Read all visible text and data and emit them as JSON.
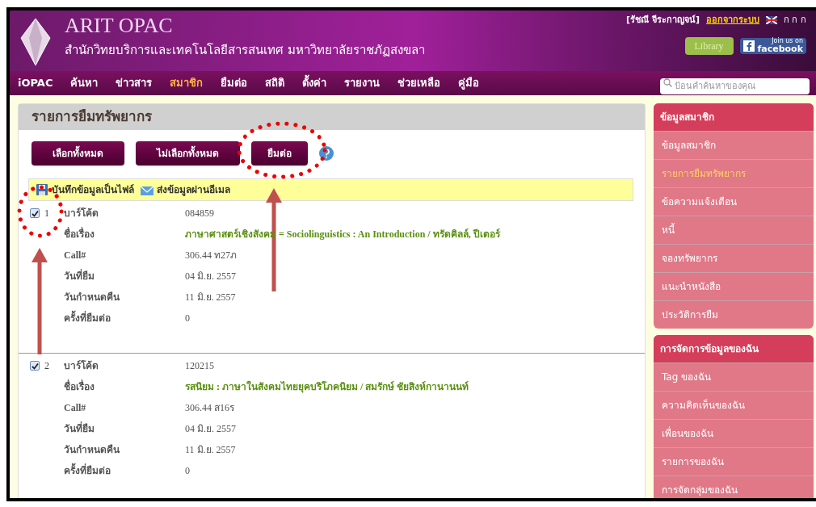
{
  "header": {
    "title": "ARIT OPAC",
    "subtitle": "สำนักวิทยบริการและเทคโนโลยีสารสนเทศ มหาวิทยาลัยราชภัฏสงขลา",
    "user": "[รัชณี จีระกาญจน์]",
    "logout": "ออกจากระบบ",
    "font_sizes": "ก ก ก",
    "library": "Library",
    "facebook_join": "Join us on",
    "facebook": "facebook"
  },
  "nav": [
    {
      "label": "iOPAC",
      "selected": false
    },
    {
      "label": "ค้นหา",
      "selected": false
    },
    {
      "label": "ข่าวสาร",
      "selected": false
    },
    {
      "label": "สมาชิก",
      "selected": true
    },
    {
      "label": "ยืมต่อ",
      "selected": false
    },
    {
      "label": "สถิติ",
      "selected": false
    },
    {
      "label": "ตั้งค่า",
      "selected": false
    },
    {
      "label": "รายงาน",
      "selected": false
    },
    {
      "label": "ช่วยเหลือ",
      "selected": false
    },
    {
      "label": "คู่มือ",
      "selected": false
    }
  ],
  "search": {
    "placeholder": "ป้อนคำค้นหาของคุณ"
  },
  "panel": {
    "title": "รายการยืมทรัพยากร",
    "buttons": [
      "เลือกทั้งหมด",
      "ไม่เลือกทั้งหมด",
      "ยืมต่อ"
    ],
    "toolbar": [
      {
        "label": "บันทึกข้อมูลเป็นไฟล์",
        "kind": "save"
      },
      {
        "label": "ส่งข้อมูลผ่านอีเมล",
        "kind": "email"
      }
    ],
    "items": [
      {
        "index": "1",
        "checked": true,
        "fields": [
          {
            "label": "บาร์โค้ด",
            "value": "084859",
            "kind": "plain"
          },
          {
            "label": "ชื่อเรื่อง",
            "value": "ภาษาศาสตร์เชิงสังคม = Sociolinguistics : An Introduction / ทรัดคิลล์, ปีเตอร์",
            "kind": "title"
          },
          {
            "label": "Call#",
            "value": "306.44 ท27ภ",
            "kind": "plain"
          },
          {
            "label": "วันที่ยืม",
            "value": "04 มิ.ย. 2557",
            "kind": "plain"
          },
          {
            "label": "วันกำหนดคืน",
            "value": "11 มิ.ย. 2557",
            "kind": "plain"
          },
          {
            "label": "ครั้งที่ยืมต่อ",
            "value": "0",
            "kind": "plain"
          }
        ]
      },
      {
        "index": "2",
        "checked": true,
        "fields": [
          {
            "label": "บาร์โค้ด",
            "value": "120215",
            "kind": "plain"
          },
          {
            "label": "ชื่อเรื่อง",
            "value": "รสนิยม : ภาษาในสังคมไทยยุคบริโภคนิยม / สมรักษ์ ชัยสิงห์กานานนท์",
            "kind": "title"
          },
          {
            "label": "Call#",
            "value": "306.44 ส16ร",
            "kind": "plain"
          },
          {
            "label": "วันที่ยืม",
            "value": "04 มิ.ย. 2557",
            "kind": "plain"
          },
          {
            "label": "วันกำหนดคืน",
            "value": "11 มิ.ย. 2557",
            "kind": "plain"
          },
          {
            "label": "ครั้งที่ยืมต่อ",
            "value": "0",
            "kind": "plain"
          }
        ]
      }
    ]
  },
  "sidebar": [
    {
      "title": "ข้อมูลสมาชิก",
      "items": [
        {
          "label": "ข้อมูลสมาชิก",
          "selected": false
        },
        {
          "label": "รายการยืมทรัพยากร",
          "selected": true
        },
        {
          "label": "ข้อความแจ้งเตือน",
          "selected": false
        },
        {
          "label": "หนี้",
          "selected": false
        },
        {
          "label": "จองทรัพยากร",
          "selected": false
        },
        {
          "label": "แนะนำหนังสือ",
          "selected": false
        },
        {
          "label": "ประวัติการยืม",
          "selected": false
        }
      ]
    },
    {
      "title": "การจัดการข้อมูลของฉัน",
      "items": [
        {
          "label": "Tag ของฉัน",
          "selected": false
        },
        {
          "label": "ความคิดเห็นของฉัน",
          "selected": false
        },
        {
          "label": "เพื่อนของฉัน",
          "selected": false
        },
        {
          "label": "รายการของฉัน",
          "selected": false
        },
        {
          "label": "การจัดกลุ่มของฉัน",
          "selected": false
        }
      ]
    }
  ]
}
